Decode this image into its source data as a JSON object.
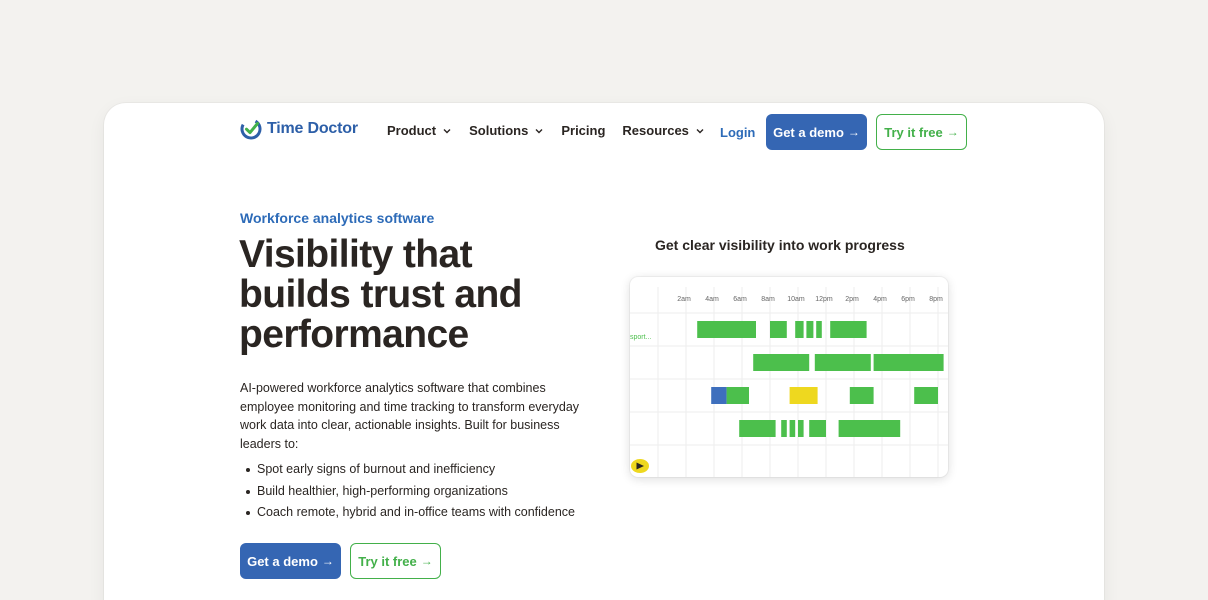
{
  "brand": {
    "name": "Time Doctor",
    "primary_color": "#3566b3",
    "accent_color": "#43b04a"
  },
  "nav": {
    "menu": [
      {
        "label": "Product",
        "has_dropdown": true
      },
      {
        "label": "Solutions",
        "has_dropdown": true
      },
      {
        "label": "Pricing",
        "has_dropdown": false
      },
      {
        "label": "Resources",
        "has_dropdown": true
      }
    ],
    "login": "Login",
    "demo_label": "Get a demo",
    "try_label": "Try it free",
    "arrow": "→"
  },
  "hero": {
    "eyebrow": "Workforce analytics software",
    "headline": "Visibility that builds trust and performance",
    "description": "AI-powered workforce analytics software that combines employee monitoring and time tracking to transform everyday work data into clear, actionable insights. Built for business leaders to:",
    "bullets": [
      "Spot early signs of burnout and inefficiency",
      "Build healthier, high-performing organizations",
      "Coach remote, hybrid and in-office teams with confidence"
    ],
    "demo_label": "Get a demo",
    "try_label": "Try it free",
    "arrow": "→"
  },
  "visual": {
    "title": "Get clear visibility into work progress",
    "row_label": "sport...",
    "time_labels": [
      "2am",
      "4am",
      "6am",
      "8am",
      "10am",
      "12pm",
      "2pm",
      "4pm",
      "6pm",
      "8pm"
    ],
    "colors": {
      "active": "#4cbf4c",
      "idle": "#eed81f",
      "manual": "#3e6fbd",
      "grid": "#eeeeee"
    },
    "rows": [
      {
        "segments": [
          {
            "start": 1.4,
            "end": 3.5,
            "type": "active"
          },
          {
            "start": 4.0,
            "end": 4.6,
            "type": "active"
          },
          {
            "start": 4.9,
            "end": 5.2,
            "type": "active"
          },
          {
            "start": 5.3,
            "end": 5.55,
            "type": "active"
          },
          {
            "start": 5.65,
            "end": 5.85,
            "type": "active"
          },
          {
            "start": 6.15,
            "end": 7.45,
            "type": "active"
          }
        ]
      },
      {
        "segments": [
          {
            "start": 3.4,
            "end": 5.4,
            "type": "active"
          },
          {
            "start": 5.6,
            "end": 7.6,
            "type": "active"
          },
          {
            "start": 7.7,
            "end": 10.2,
            "type": "active"
          }
        ]
      },
      {
        "segments": [
          {
            "start": 1.9,
            "end": 2.45,
            "type": "manual"
          },
          {
            "start": 2.45,
            "end": 3.25,
            "type": "active"
          },
          {
            "start": 4.7,
            "end": 5.7,
            "type": "idle"
          },
          {
            "start": 6.85,
            "end": 7.7,
            "type": "active"
          },
          {
            "start": 9.15,
            "end": 10.0,
            "type": "active"
          }
        ]
      },
      {
        "segments": [
          {
            "start": 2.9,
            "end": 4.2,
            "type": "active"
          },
          {
            "start": 4.4,
            "end": 4.6,
            "type": "active"
          },
          {
            "start": 4.7,
            "end": 4.9,
            "type": "active"
          },
          {
            "start": 5.0,
            "end": 5.2,
            "type": "active"
          },
          {
            "start": 5.4,
            "end": 6.0,
            "type": "active"
          },
          {
            "start": 6.45,
            "end": 8.65,
            "type": "active"
          }
        ]
      }
    ]
  }
}
